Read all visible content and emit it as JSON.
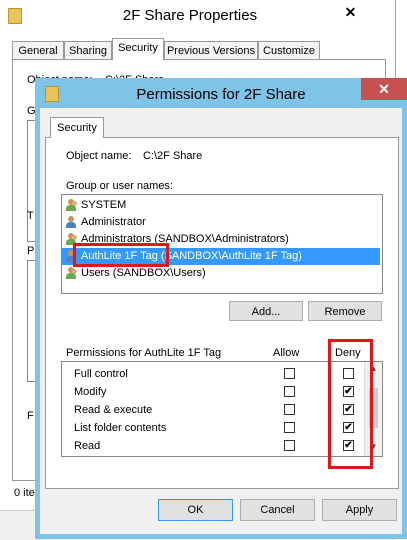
{
  "background_window": {
    "title": "2F Share Properties",
    "close_glyph": "✕",
    "tabs": [
      "General",
      "Sharing",
      "Security",
      "Previous Versions",
      "Customize"
    ],
    "selected_tab": "Security",
    "fragments": {
      "object": "Object name:",
      "object_value": "C:\\2F Share",
      "g": "G",
      "t": "T",
      "p": "P",
      "f": "F",
      "items": "0 ite"
    }
  },
  "dialog": {
    "title": "Permissions for 2F Share",
    "close_glyph": "✕",
    "tab": "Security",
    "object_name_label": "Object name:",
    "object_name_value": "C:\\2F Share",
    "group_label": "Group or user names:",
    "principals": [
      {
        "name": "SYSTEM",
        "icon": "group-icon",
        "selected": false
      },
      {
        "name": "Administrator",
        "icon": "user-icon",
        "selected": false
      },
      {
        "name": "Administrators (SANDBOX\\Administrators)",
        "icon": "group-icon",
        "selected": false
      },
      {
        "name": "AuthLite 1F Tag (SANDBOX\\AuthLite 1F Tag)",
        "icon": "user-icon",
        "selected": true
      },
      {
        "name": "Users (SANDBOX\\Users)",
        "icon": "group-icon",
        "selected": false
      }
    ],
    "add_button": "Add...",
    "remove_button": "Remove",
    "permissions_label": "Permissions for AuthLite 1F Tag",
    "allow_header": "Allow",
    "deny_header": "Deny",
    "permissions": [
      {
        "name": "Full control",
        "allow": false,
        "deny": false
      },
      {
        "name": "Modify",
        "allow": false,
        "deny": true
      },
      {
        "name": "Read & execute",
        "allow": false,
        "deny": true
      },
      {
        "name": "List folder contents",
        "allow": false,
        "deny": true
      },
      {
        "name": "Read",
        "allow": false,
        "deny": true
      }
    ],
    "check_glyph": "✔",
    "scroll_up": "▲",
    "scroll_down": "▼",
    "ok_button": "OK",
    "cancel_button": "Cancel",
    "apply_button": "Apply"
  },
  "colors": {
    "dialog_frame": "#7ec3e8",
    "selection": "#3399ff",
    "highlight_annotation": "#e0161b",
    "close_button": "#c75050"
  }
}
